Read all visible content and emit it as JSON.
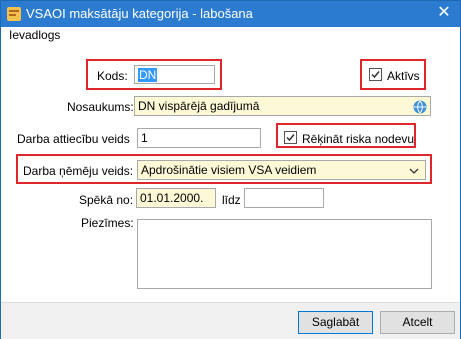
{
  "window": {
    "title": "VSAOI maksātāju kategorija - labošana",
    "close_glyph": "✕"
  },
  "section": {
    "label": "Ievadlogs"
  },
  "fields": {
    "kods": {
      "label": "Kods:",
      "value": "DN"
    },
    "aktivs": {
      "label": "Aktīvs",
      "checked": true
    },
    "nosaukums": {
      "label": "Nosaukums:",
      "value": "DN vispārējā gadījumā"
    },
    "darba_attiecibu_veids": {
      "label": "Darba attiecību veids",
      "value": "1"
    },
    "rekinat_riska": {
      "label": "Rēķināt riska nodevu",
      "checked": true
    },
    "darba_nemeju_veids": {
      "label": "Darba ņēmēju veids:",
      "value": "Apdrošinātie visiem VSA veidiem"
    },
    "speka_no": {
      "label": "Spēkā no:",
      "value": "01.01.2000."
    },
    "lidz": {
      "label": "līdz",
      "value": ""
    },
    "piezimes": {
      "label": "Piezīmes:",
      "value": ""
    }
  },
  "buttons": {
    "save": "Saglabāt",
    "cancel": "Atcelt"
  },
  "colors": {
    "titlebar": "#2b7bd1",
    "highlight": "#e0262b",
    "required_field": "#fdf9d6"
  }
}
